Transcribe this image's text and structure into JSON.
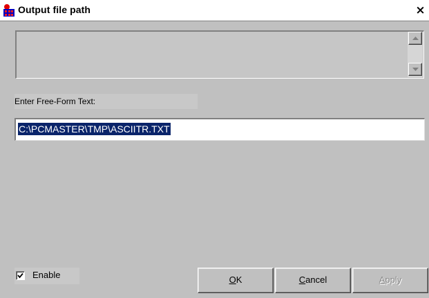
{
  "window": {
    "title": "Output file path",
    "close_glyph": "×"
  },
  "message_area": {
    "text": ""
  },
  "form": {
    "label": "Enter Free-Form Text:",
    "input_value": "C:\\PCMASTER\\TMP\\ASCIITR.TXT"
  },
  "enable": {
    "label": "Enable",
    "checked": true
  },
  "buttons": {
    "ok": {
      "mnemonic": "O",
      "rest": "K"
    },
    "cancel": {
      "mnemonic": "C",
      "rest": "ancel"
    },
    "apply": {
      "mnemonic": "A",
      "rest": "pply",
      "disabled": true
    }
  },
  "colors": {
    "face": "#c0c0c0",
    "selection": "#0a246a"
  },
  "icons": [
    "app-icon",
    "close-icon",
    "scroll-up-icon",
    "scroll-down-icon",
    "checkmark-icon"
  ]
}
